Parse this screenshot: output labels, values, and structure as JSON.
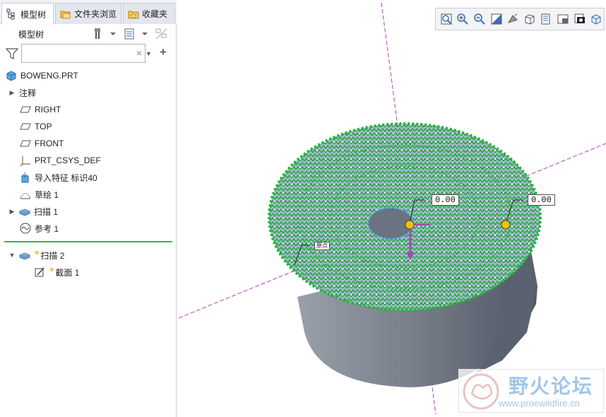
{
  "tabs": [
    {
      "label": "模型树",
      "icon": "model-tree-icon",
      "active": true
    },
    {
      "label": "文件夹浏览",
      "icon": "folder-browser-icon",
      "active": false
    },
    {
      "label": "收藏夹",
      "icon": "favorites-icon",
      "active": false
    }
  ],
  "panel": {
    "title": "模型树",
    "settings_icon": "tree-settings-icon",
    "columns_icon": "tree-columns-icon",
    "show_icon": "tree-filter-icon"
  },
  "search": {
    "value": "",
    "placeholder": "",
    "clear": "×"
  },
  "tree": {
    "root": "BOWENG.PRT",
    "items": [
      {
        "label": "注释",
        "expander": "▶",
        "icon": "none"
      },
      {
        "label": "RIGHT",
        "icon": "datum-plane-icon"
      },
      {
        "label": "TOP",
        "icon": "datum-plane-icon"
      },
      {
        "label": "FRONT",
        "icon": "datum-plane-icon"
      },
      {
        "label": "PRT_CSYS_DEF",
        "icon": "csys-icon"
      },
      {
        "label": "导入特征 标识40",
        "icon": "import-feature-icon"
      },
      {
        "label": "草绘 1",
        "icon": "sketch-icon"
      },
      {
        "label": "扫描 1",
        "expander": "▶",
        "icon": "sweep-icon"
      },
      {
        "label": "参考 1",
        "icon": "reference-icon"
      }
    ],
    "active_items": [
      {
        "label": "扫描 2",
        "expander": "▼",
        "icon": "sweep-icon",
        "marker": "✳"
      },
      {
        "label": "截面 1",
        "icon": "section-icon",
        "marker": "✳"
      }
    ]
  },
  "viewport": {
    "dimension_1": "0.00",
    "dimension_2": "0.00",
    "note_label": "原点",
    "toolbar_icons": [
      "refit-icon",
      "zoom-in-icon",
      "zoom-out-icon",
      "repaint-icon",
      "display-style-icon",
      "saved-orientations-icon",
      "view-manager-icon",
      "datum-display-icon",
      "annotation-display-icon",
      "spin-center-icon"
    ]
  },
  "watermark": {
    "title": "野火论坛",
    "url": "www.proewildfire.cn"
  },
  "colors": {
    "accent_green": "#39b54a",
    "mesh_green": "#22b43a",
    "body_gray": "#6f7785",
    "datum_purple": "#b040c0"
  }
}
